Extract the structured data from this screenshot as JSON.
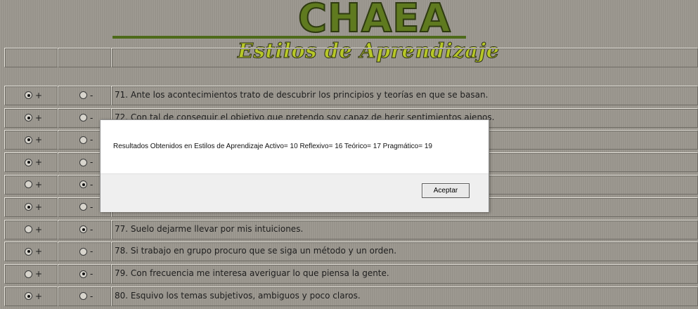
{
  "header": {
    "title": "CHAEA",
    "subtitle": "Estilos de Aprendizaje"
  },
  "partial_row_text": "",
  "rows": [
    {
      "plus_label": "+",
      "minus_label": "-",
      "selected": "plus",
      "text": "71. Ante los acontecimientos trato de descubrir los principios y teorías en que se basan."
    },
    {
      "plus_label": "+",
      "minus_label": "-",
      "selected": "plus",
      "text": "72. Con tal de conseguir el objetivo que pretendo soy capaz de herir sentimientos ajenos."
    },
    {
      "plus_label": "+",
      "minus_label": "-",
      "selected": "plus",
      "text": ""
    },
    {
      "plus_label": "+",
      "minus_label": "-",
      "selected": "plus",
      "text": ""
    },
    {
      "plus_label": "+",
      "minus_label": "-",
      "selected": "minus",
      "text": ""
    },
    {
      "plus_label": "+",
      "minus_label": "-",
      "selected": "plus",
      "text": ""
    },
    {
      "plus_label": "+",
      "minus_label": "-",
      "selected": "minus",
      "text": "77. Suelo dejarme llevar por mis intuiciones."
    },
    {
      "plus_label": "+",
      "minus_label": "-",
      "selected": "plus",
      "text": "78. Si trabajo en grupo procuro que se siga un método y un orden."
    },
    {
      "plus_label": "+",
      "minus_label": "-",
      "selected": "minus",
      "text": "79. Con frecuencia me interesa averiguar lo que piensa la gente."
    },
    {
      "plus_label": "+",
      "minus_label": "-",
      "selected": "plus",
      "text": "80. Esquivo los temas subjetivos, ambiguos y poco claros."
    }
  ],
  "dialog": {
    "message": "Resultados Obtenidos en Estilos de Aprendizaje   Activo= 10  Reflexivo= 16  Teórico= 17  Pragmático= 19",
    "ok_label": "Aceptar"
  },
  "colors": {
    "background": "#9c9890",
    "logo_green": "#5f7a1f",
    "logo_yellow": "#b7c728"
  }
}
